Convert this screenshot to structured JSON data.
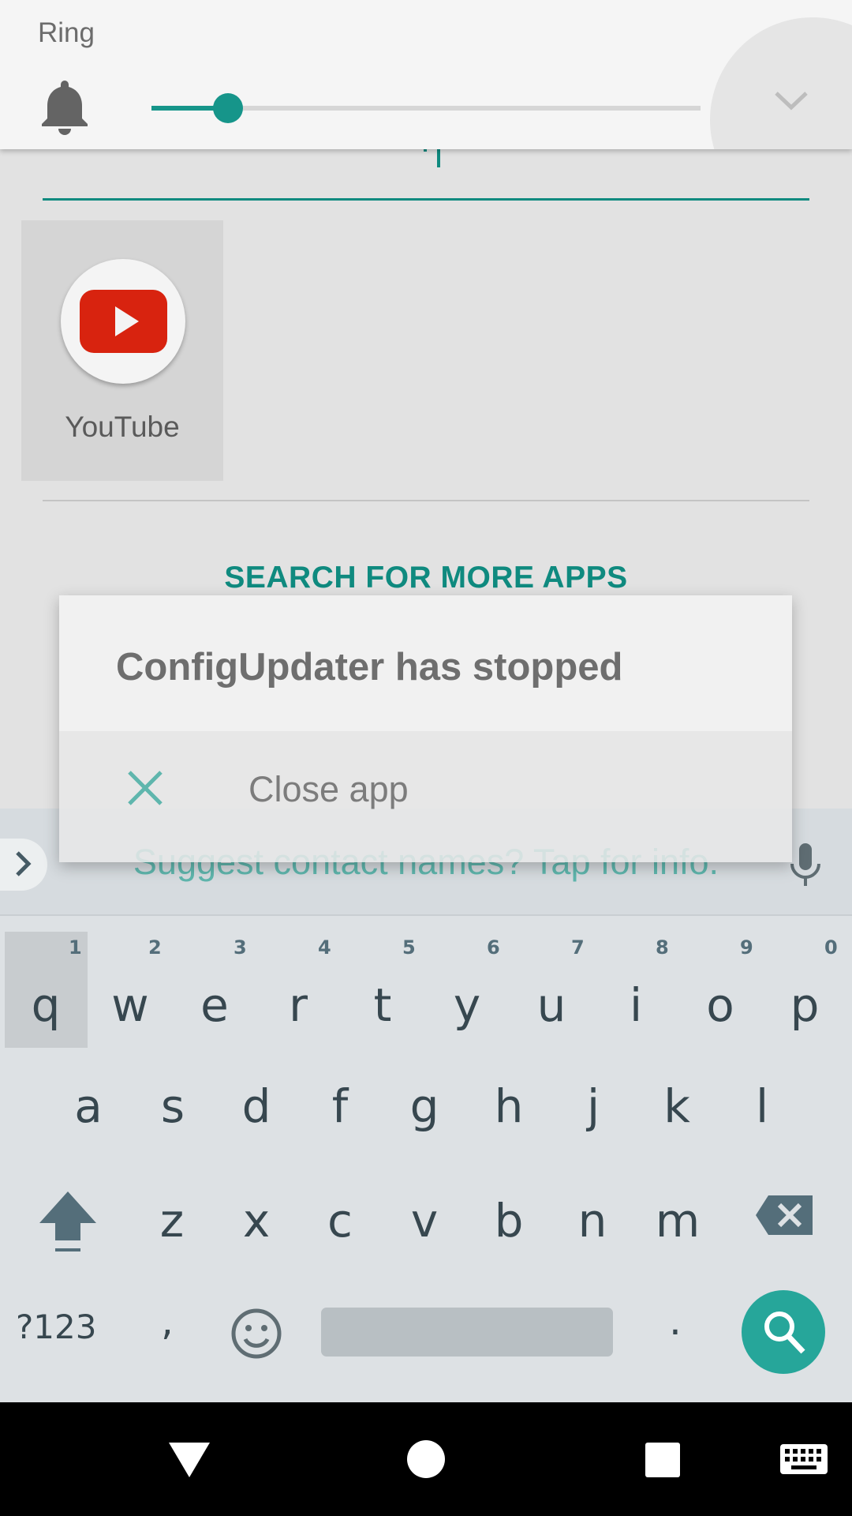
{
  "volume_panel": {
    "label": "Ring",
    "level_fraction": 0.14,
    "icons": {
      "ringer": "bell-icon",
      "expand": "chevron-down-icon"
    }
  },
  "launcher": {
    "search_query": "",
    "app_results": [
      {
        "name": "YouTube",
        "icon": "youtube-icon"
      }
    ],
    "more_apps_label": "SEARCH FOR MORE APPS"
  },
  "dialog": {
    "title": "ConfigUpdater has stopped",
    "action_label": "Close app",
    "action_icon": "close-icon"
  },
  "suggestion_strip": {
    "text": "Suggest contact names? Tap for info.",
    "icons": {
      "expand": "chevron-right-icon",
      "voice": "mic-icon"
    }
  },
  "keyboard": {
    "row1": [
      {
        "key": "q",
        "hint": "1"
      },
      {
        "key": "w",
        "hint": "2"
      },
      {
        "key": "e",
        "hint": "3"
      },
      {
        "key": "r",
        "hint": "4"
      },
      {
        "key": "t",
        "hint": "5"
      },
      {
        "key": "y",
        "hint": "6"
      },
      {
        "key": "u",
        "hint": "7"
      },
      {
        "key": "i",
        "hint": "8"
      },
      {
        "key": "o",
        "hint": "9"
      },
      {
        "key": "p",
        "hint": "0"
      }
    ],
    "row2": [
      "a",
      "s",
      "d",
      "f",
      "g",
      "h",
      "j",
      "k",
      "l"
    ],
    "row3": [
      "z",
      "x",
      "c",
      "v",
      "b",
      "n",
      "m"
    ],
    "symbols_label": "?123",
    "comma_label": ",",
    "period_label": ".",
    "icons": {
      "shift": "shift-icon",
      "backspace": "backspace-icon",
      "emoji": "emoji-icon",
      "search": "search-icon"
    }
  },
  "navbar": {
    "icons": [
      "back-icon",
      "home-icon",
      "recents-icon",
      "keyboard-switch-icon"
    ]
  },
  "colors": {
    "accent": "#0f8a7f",
    "search_key": "#26a69a",
    "youtube_red": "#d8230f",
    "keyboard_bg": "#dde1e4"
  }
}
